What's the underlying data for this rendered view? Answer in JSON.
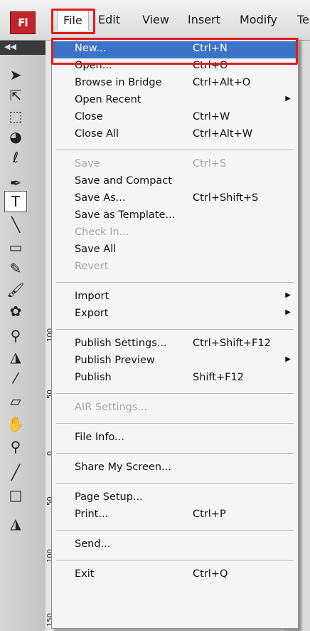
{
  "app": {
    "logo_text": "Fl"
  },
  "menubar": {
    "items": [
      "File",
      "Edit",
      "View",
      "Insert",
      "Modify",
      "Te"
    ]
  },
  "rulers": [
    "100",
    "50",
    "0",
    "50",
    "100",
    "150"
  ],
  "file_menu": [
    {
      "label": "New...",
      "shortcut": "Ctrl+N",
      "highlighted": true
    },
    {
      "label": "Open...",
      "shortcut": "Ctrl+O"
    },
    {
      "label": "Browse in Bridge",
      "shortcut": "Ctrl+Alt+O"
    },
    {
      "label": "Open Recent",
      "shortcut": "",
      "submenu": true
    },
    {
      "label": "Close",
      "shortcut": "Ctrl+W"
    },
    {
      "label": "Close All",
      "shortcut": "Ctrl+Alt+W"
    },
    {
      "sep": true
    },
    {
      "label": "Save",
      "shortcut": "Ctrl+S",
      "disabled": true
    },
    {
      "label": "Save and Compact",
      "shortcut": ""
    },
    {
      "label": "Save As...",
      "shortcut": "Ctrl+Shift+S"
    },
    {
      "label": "Save as Template...",
      "shortcut": ""
    },
    {
      "label": "Check In...",
      "shortcut": "",
      "disabled": true
    },
    {
      "label": "Save All",
      "shortcut": ""
    },
    {
      "label": "Revert",
      "shortcut": "",
      "disabled": true
    },
    {
      "sep": true
    },
    {
      "label": "Import",
      "shortcut": "",
      "submenu": true
    },
    {
      "label": "Export",
      "shortcut": "",
      "submenu": true
    },
    {
      "sep": true
    },
    {
      "label": "Publish Settings...",
      "shortcut": "Ctrl+Shift+F12"
    },
    {
      "label": "Publish Preview",
      "shortcut": "",
      "submenu": true
    },
    {
      "label": "Publish",
      "shortcut": "Shift+F12"
    },
    {
      "sep": true
    },
    {
      "label": "AIR Settings...",
      "shortcut": "",
      "disabled": true
    },
    {
      "sep": true
    },
    {
      "label": "File Info...",
      "shortcut": ""
    },
    {
      "sep": true
    },
    {
      "label": "Share My Screen...",
      "shortcut": ""
    },
    {
      "sep": true
    },
    {
      "label": "Page Setup...",
      "shortcut": ""
    },
    {
      "label": "Print...",
      "shortcut": "Ctrl+P"
    },
    {
      "sep": true
    },
    {
      "label": "Send...",
      "shortcut": ""
    },
    {
      "sep": true
    },
    {
      "label": "Exit",
      "shortcut": "Ctrl+Q"
    }
  ],
  "tools": [
    {
      "name": "selection-tool-icon",
      "glyph": "➤"
    },
    {
      "name": "subselection-tool-icon",
      "glyph": "⇱"
    },
    {
      "name": "free-transform-tool-icon",
      "glyph": "⬚"
    },
    {
      "name": "3d-rotation-tool-icon",
      "glyph": "◕"
    },
    {
      "name": "lasso-tool-icon",
      "glyph": "ℓ"
    },
    {
      "name": "pen-tool-icon",
      "glyph": "✒"
    },
    {
      "name": "text-tool-icon",
      "glyph": "T",
      "selected": true
    },
    {
      "name": "line-tool-icon",
      "glyph": "╲"
    },
    {
      "name": "rectangle-tool-icon",
      "glyph": "▭"
    },
    {
      "name": "pencil-tool-icon",
      "glyph": "✎"
    },
    {
      "name": "brush-tool-icon",
      "glyph": "🖌"
    },
    {
      "name": "deco-tool-icon",
      "glyph": "✿"
    },
    {
      "name": "bone-tool-icon",
      "glyph": "⚲"
    },
    {
      "name": "paint-bucket-tool-icon",
      "glyph": "◮"
    },
    {
      "name": "eyedropper-tool-icon",
      "glyph": "⁄"
    },
    {
      "name": "eraser-tool-icon",
      "glyph": "▱"
    },
    {
      "name": "hand-tool-icon",
      "glyph": "✋"
    },
    {
      "name": "zoom-tool-icon",
      "glyph": "⚲"
    },
    {
      "name": "stroke-color-icon",
      "glyph": "╱"
    },
    {
      "name": "fill-color-icon",
      "glyph": "□"
    },
    {
      "name": "paint-bucket-small-icon",
      "glyph": "◮"
    }
  ]
}
